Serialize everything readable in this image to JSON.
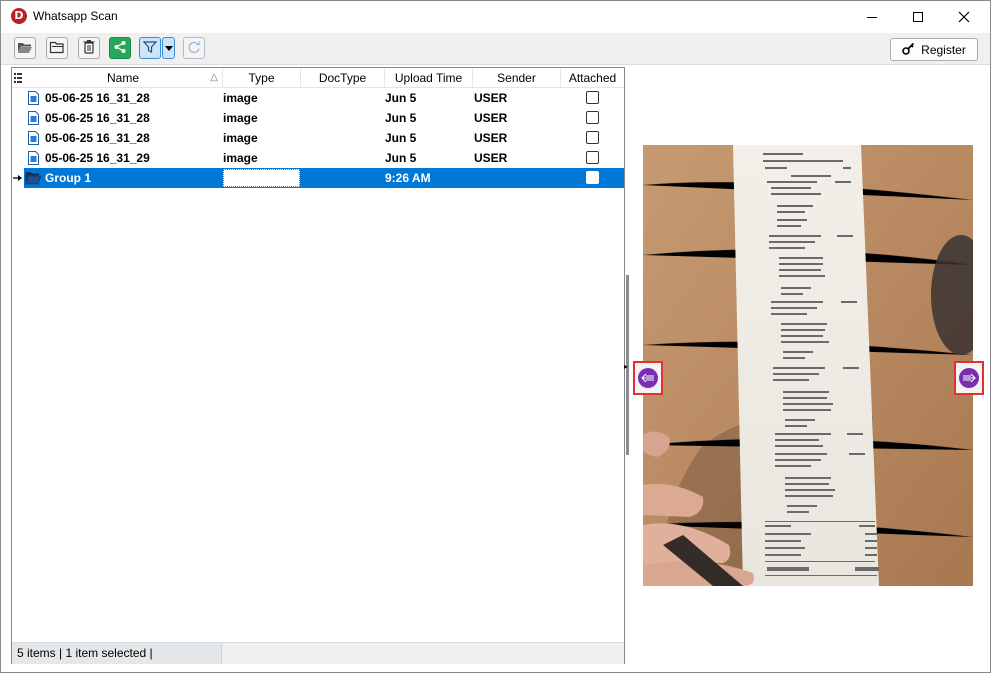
{
  "window": {
    "title": "Whatsapp Scan"
  },
  "toolbar": {
    "register_label": "Register"
  },
  "list": {
    "columns": [
      "Name",
      "Type",
      "DocType",
      "Upload Time",
      "Sender",
      "Attached"
    ],
    "rows": [
      {
        "name": "05-06-25 16_31_28",
        "type": "image",
        "doctype": "",
        "upload_time": "Jun 5",
        "sender": "USER",
        "attached": false
      },
      {
        "name": "05-06-25 16_31_28",
        "type": "image",
        "doctype": "",
        "upload_time": "Jun 5",
        "sender": "USER",
        "attached": false
      },
      {
        "name": "05-06-25 16_31_28",
        "type": "image",
        "doctype": "",
        "upload_time": "Jun 5",
        "sender": "USER",
        "attached": false
      },
      {
        "name": "05-06-25 16_31_29",
        "type": "image",
        "doctype": "",
        "upload_time": "Jun 5",
        "sender": "USER",
        "attached": false
      },
      {
        "name": "Group 1",
        "type": "",
        "doctype": "",
        "upload_time": "9:26 AM",
        "sender": "",
        "attached": false,
        "selected": true
      }
    ]
  },
  "status": {
    "text": "5 items |  1 item selected |"
  },
  "receipt": {
    "header": "Cashier: Ryan",
    "pax": "PAX No: 1",
    "staff": "Qty item",
    "dine_in": "** Dine In **",
    "items": [
      {
        "name": "Single Plate (Set Lunch)",
        "price": "11.90"
      },
      {
        "name": "Single Plate (Set Lunch)",
        "price": "11.90"
      },
      {
        "name": "Single Plate (Set Lunch)",
        "price": "13.90"
      },
      {
        "name": "Single Plate (Set Lunch)",
        "price": "13.50"
      },
      {
        "name": "Pineapple Fried Rice with Bacon",
        "price": "12.90"
      },
      {
        "name": "Single Plate (Set Lunch)",
        "price": "13.50"
      }
    ],
    "subtotal_label": "Subtotal",
    "subtotal": "77.60",
    "service_charge_label": "Service Charge",
    "service_charge": "4.66",
    "sst_label": "Service Tax",
    "sst": "4.66",
    "rounding_label": "Rounding Adj",
    "rounding": "-0.02",
    "net_total_label": "Net Total",
    "net_total": "86.90"
  },
  "icons": {
    "open": "folder-open-icon",
    "open2": "folder-open-outline-icon",
    "delete": "trash-icon",
    "share": "share-icon",
    "filter": "filter-icon",
    "refresh": "refresh-icon",
    "register": "key-icon",
    "prev": "arrow-left-icon",
    "next": "arrow-right-icon"
  },
  "colors": {
    "selection": "#0078d7",
    "accent_green": "#25a85a",
    "nav_purple": "#7b2fb0",
    "nav_border": "#e03232",
    "logo_red": "#b8202a"
  }
}
